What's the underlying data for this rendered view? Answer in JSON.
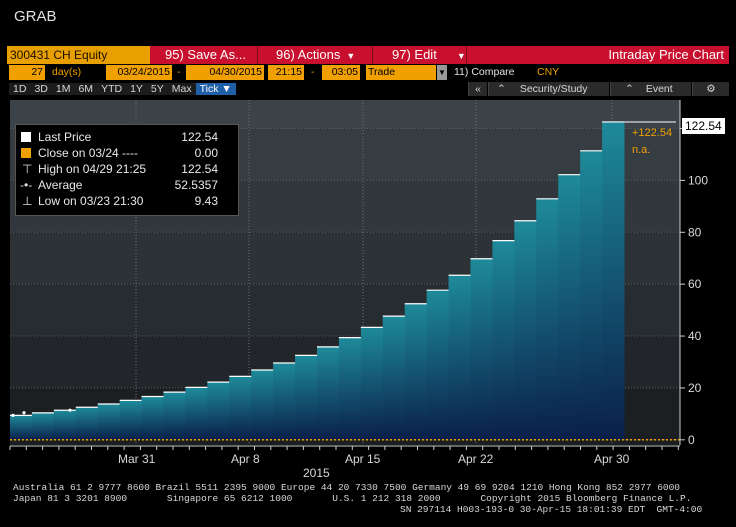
{
  "window": {
    "title": "GRAB"
  },
  "toolbar": {
    "ticker": "300431 CH Equity",
    "save_as": "95) Save As...",
    "actions": "96) Actions",
    "edit": "97) Edit",
    "chart_name": "Intraday Price Chart"
  },
  "settings": {
    "days": "27",
    "days_unit": "day(s)",
    "start_date": "03/24/2015",
    "dash1": "-",
    "end_date": "04/30/2015",
    "start_time": "21:15",
    "dash2": "-",
    "end_time": "03:05",
    "type": "Trade",
    "compare": "11) Compare",
    "currency": "CNY"
  },
  "ranges": {
    "items": [
      "1D",
      "3D",
      "1M",
      "6M",
      "YTD",
      "1Y",
      "5Y",
      "Max"
    ],
    "active": "Tick",
    "collapse": "«",
    "security_study": "Security/Study",
    "event": "Event"
  },
  "legend": {
    "rows": [
      {
        "label": "Last Price",
        "value": "122.54"
      },
      {
        "label": "Close on 03/24 ----",
        "value": "0.00"
      },
      {
        "label": "High on 04/29 21:25",
        "value": "122.54"
      },
      {
        "label": "Average",
        "value": "52.5357"
      },
      {
        "label": "Low on 03/23 21:30",
        "value": "9.43"
      }
    ]
  },
  "price_tag": {
    "last": "122.54",
    "change": "+122.54",
    "pct": "n.a."
  },
  "chart_data": {
    "type": "area",
    "title": "",
    "xlabel": "2015",
    "ylabel": "",
    "x_ticks": [
      "Mar 31",
      "Apr 8",
      "Apr 15",
      "Apr 22",
      "Apr 30"
    ],
    "y_ticks": [
      0,
      20,
      40,
      60,
      80,
      100,
      120
    ],
    "ylim": [
      -2,
      131
    ],
    "step_values": [
      9.43,
      10.37,
      11.41,
      12.55,
      13.81,
      15.19,
      16.71,
      18.38,
      20.22,
      22.24,
      24.46,
      26.91,
      29.6,
      32.56,
      35.82,
      39.4,
      43.34,
      47.67,
      52.44,
      57.68,
      63.45,
      69.8,
      76.78,
      84.46,
      92.91,
      102.2,
      111.42,
      122.54
    ],
    "last_price": 122.54,
    "colors": {
      "area_top": "#1e8a9a",
      "area_bottom": "#0a1f4a",
      "step_line": "#ffffff",
      "zero_line": "#f0a000"
    }
  },
  "footer": {
    "line1": "Australia 61 2 9777 8600 Brazil 5511 2395 9000 Europe 44 20 7330 7500 Germany 49 69 9204 1210 Hong Kong 852 2977 6000",
    "line2": "Japan 81 3 3201 8900       Singapore 65 6212 1000       U.S. 1 212 318 2000       Copyright 2015 Bloomberg Finance L.P.",
    "line3": "SN 297114 H003-193-0 30-Apr-15 18:01:39 EDT  GMT-4:00"
  }
}
